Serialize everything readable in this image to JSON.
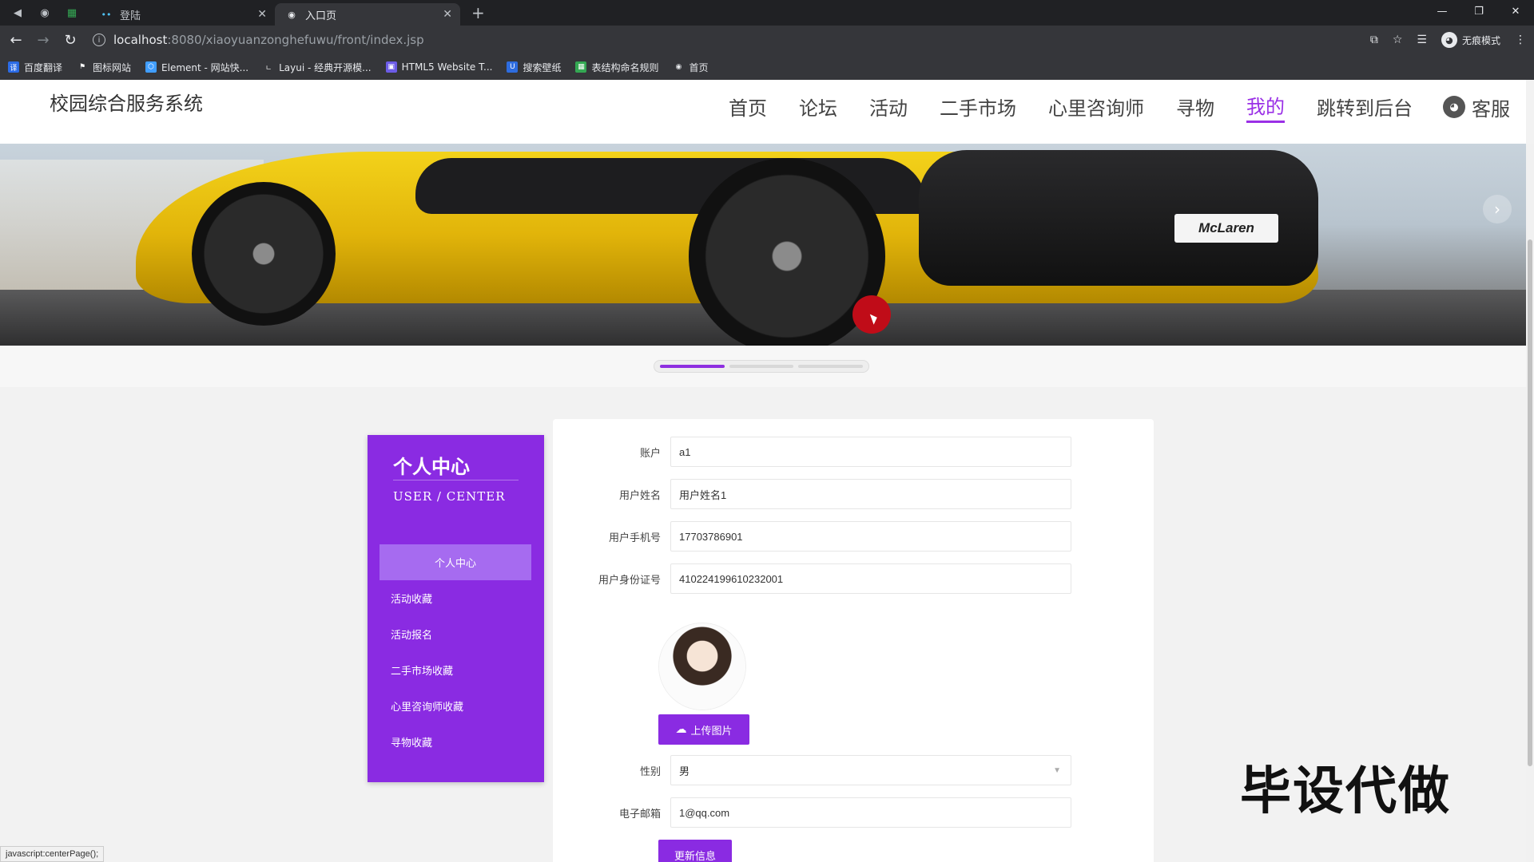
{
  "browser": {
    "tabs": [
      {
        "title": "登陆",
        "active": false
      },
      {
        "title": "入口页",
        "active": true
      }
    ],
    "url_host": "localhost",
    "url_path": ":8080/xiaoyuanzonghefuwu/front/index.jsp",
    "profile_label": "无痕模式",
    "bookmarks": [
      "百度翻译",
      "图标网站",
      "Element - 网站快...",
      "Layui - 经典开源模...",
      "HTML5 Website T...",
      "搜索壁纸",
      "表结构命名规则",
      "首页"
    ]
  },
  "header": {
    "site_title": "校园综合服务系统",
    "nav": [
      "首页",
      "论坛",
      "活动",
      "二手市场",
      "心里咨询师",
      "寻物",
      "我的",
      "跳转到后台"
    ],
    "active_nav": "我的",
    "service_label": "客服"
  },
  "banner": {
    "plate_text": "McLaren",
    "slides": 3,
    "active_slide": 1
  },
  "sidebar": {
    "title": "个人中心",
    "subtitle": "USER / CENTER",
    "items": [
      "个人中心",
      "活动收藏",
      "活动报名",
      "二手市场收藏",
      "心里咨询师收藏",
      "寻物收藏"
    ],
    "active_item": "个人中心"
  },
  "form": {
    "fields": [
      {
        "label": "账户",
        "value": "a1"
      },
      {
        "label": "用户姓名",
        "value": "用户姓名1"
      },
      {
        "label": "用户手机号",
        "value": "17703786901"
      },
      {
        "label": "用户身份证号",
        "value": "410224199610232001"
      }
    ],
    "upload_label": "上传图片",
    "gender_label": "性别",
    "gender_value": "男",
    "email_label": "电子邮箱",
    "email_value": "1@qq.com",
    "submit_label": "更新信息"
  },
  "overlay": {
    "watermark": "毕设代做",
    "status_link": "javascript:centerPage();"
  },
  "colors": {
    "accent": "#8a2be2",
    "nav_active": "#9a2fe6"
  }
}
